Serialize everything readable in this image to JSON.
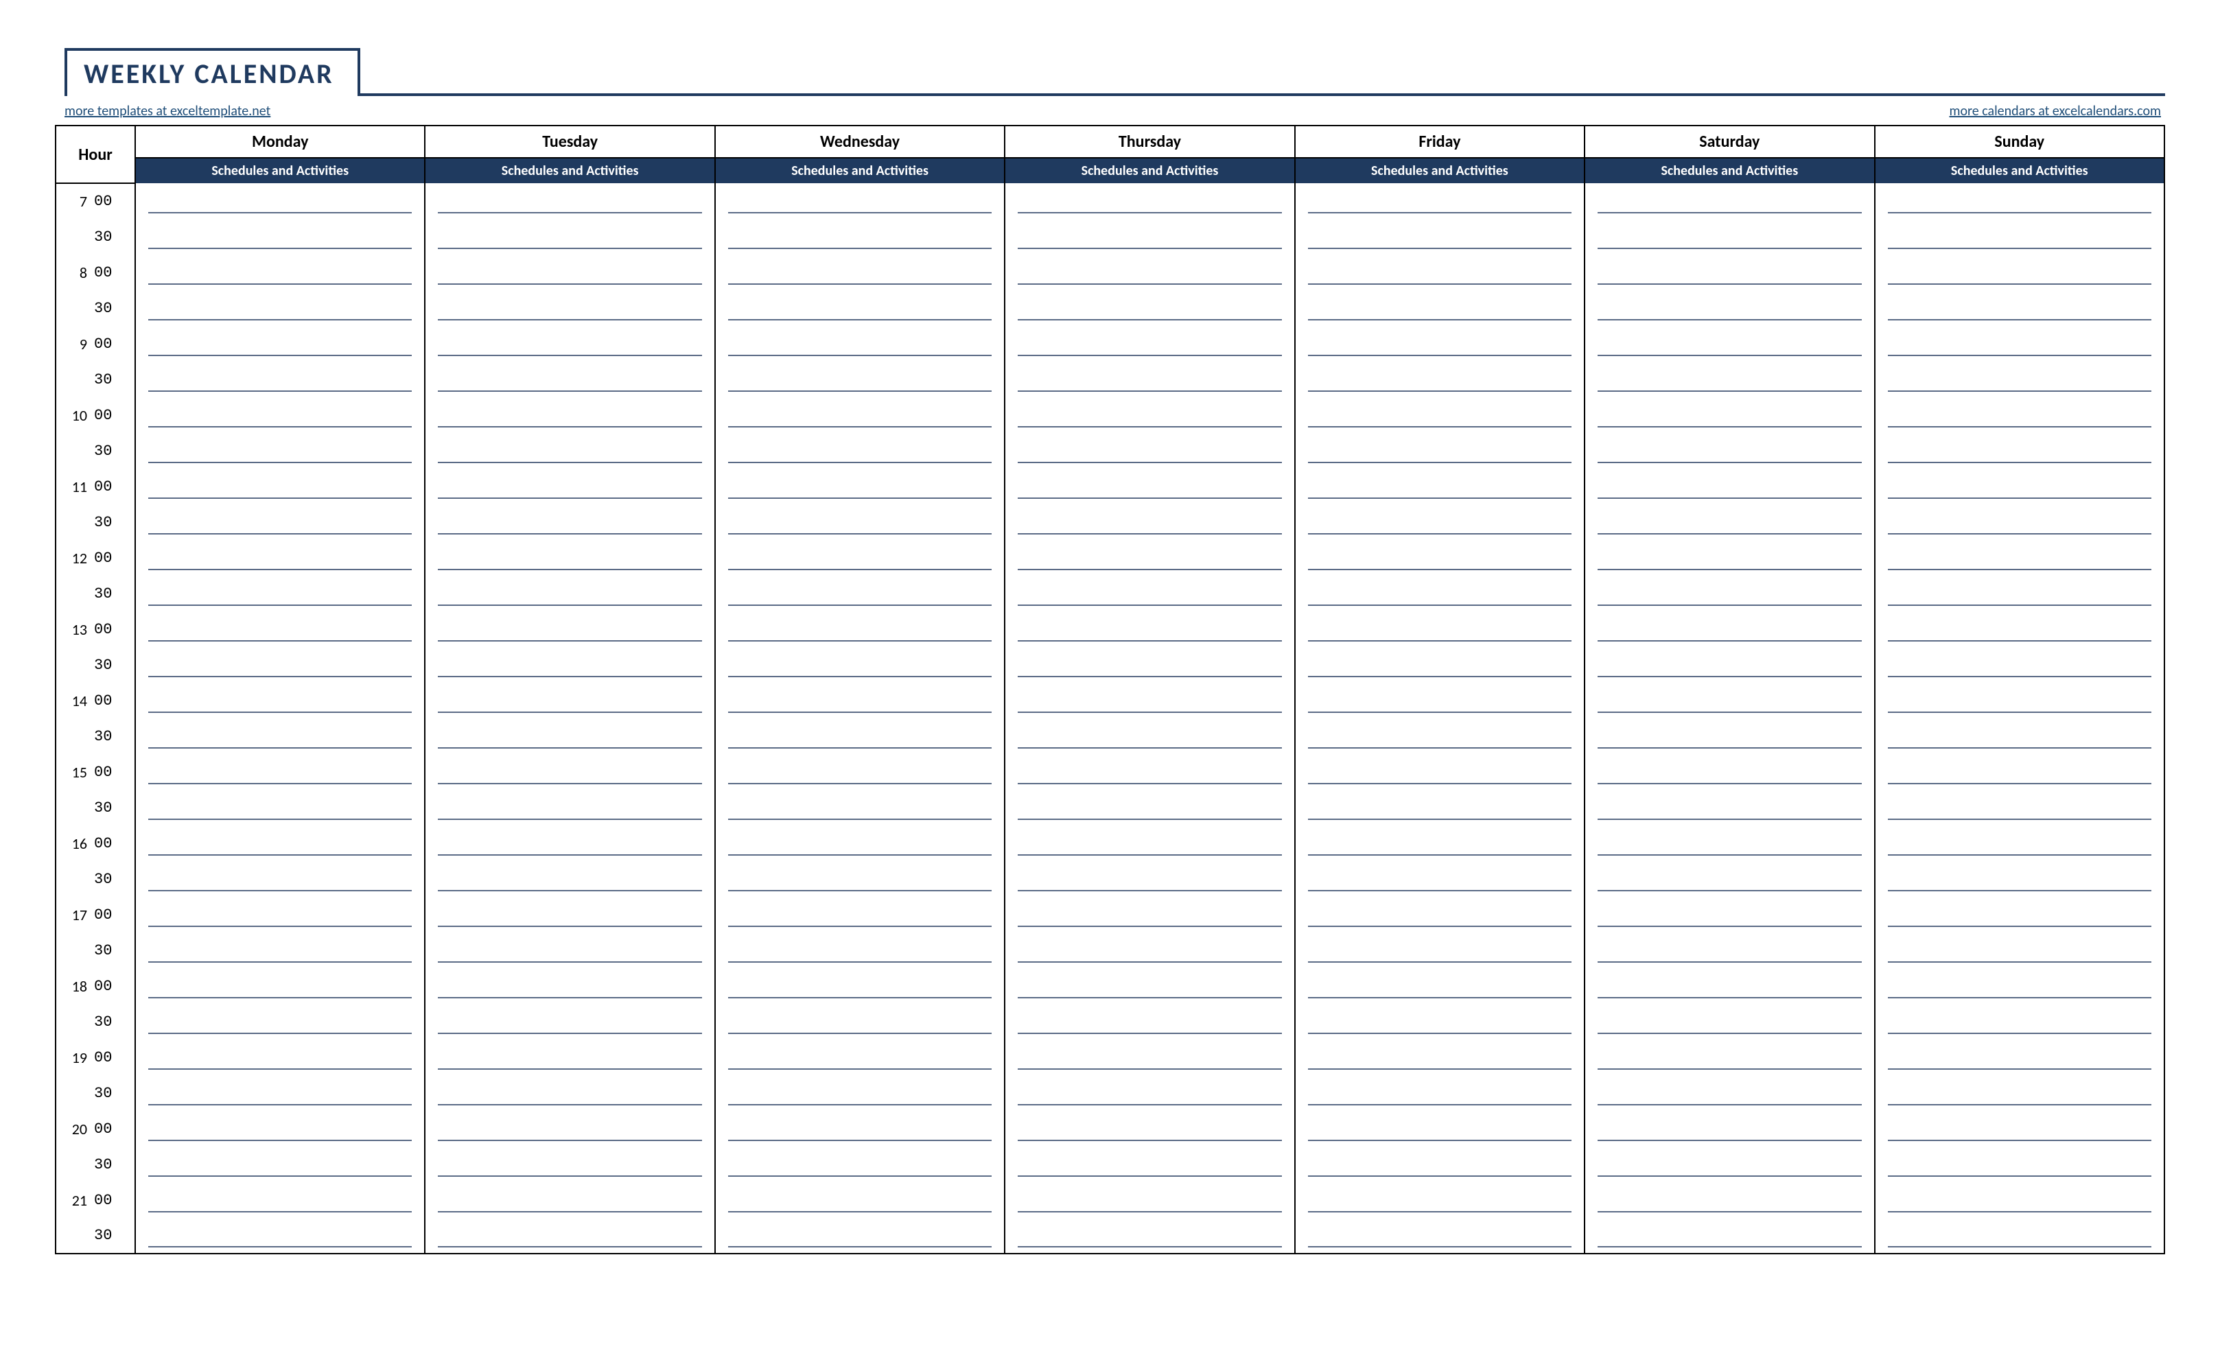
{
  "title": "WEEKLY CALENDAR",
  "links": {
    "left": "more templates at exceltemplate.net",
    "right": "more calendars at excelcalendars.com"
  },
  "header": {
    "hour": "Hour",
    "days": [
      "Monday",
      "Tuesday",
      "Wednesday",
      "Thursday",
      "Friday",
      "Saturday",
      "Sunday"
    ],
    "subheader": "Schedules and Activities"
  },
  "hours": [
    7,
    8,
    9,
    10,
    11,
    12,
    13,
    14,
    15,
    16,
    17,
    18,
    19,
    20,
    21
  ],
  "minutes": [
    "00",
    "30"
  ],
  "colors": {
    "navy": "#1f3a5f",
    "line": "#5b6b86"
  }
}
